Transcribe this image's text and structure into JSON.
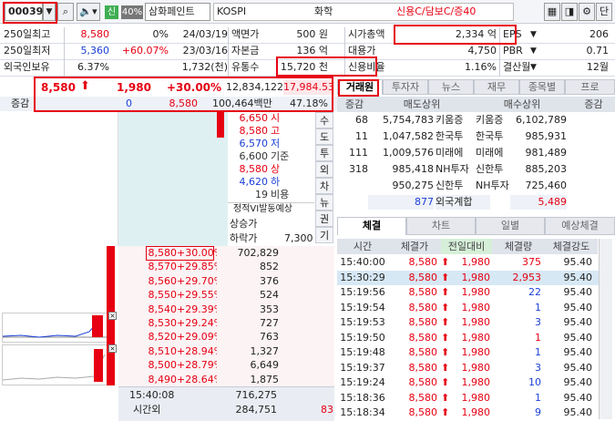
{
  "toolbar": {
    "code": "000390",
    "badge": "신",
    "pct": "40%",
    "name": "삼화페인트",
    "market": "KOSPI",
    "sector": "화학",
    "credit": "신용C/담보C/증40",
    "single_btn": "단"
  },
  "info": [
    [
      {
        "t": "250일최고"
      },
      {
        "t": "8,580",
        "c": "red"
      },
      {
        "t": "0%"
      },
      {
        "t": "24/03/19"
      },
      {
        "t": "액면가"
      },
      {
        "t": "500 원"
      },
      {
        "t": "시가총액"
      },
      {
        "t": "2,334 억"
      },
      {
        "t": "EPS"
      },
      {
        "t": "206"
      }
    ],
    [
      {
        "t": "250일최저"
      },
      {
        "t": "5,360",
        "c": "blue"
      },
      {
        "t": "+60.07%",
        "c": "red"
      },
      {
        "t": "23/03/16"
      },
      {
        "t": "자본금"
      },
      {
        "t": "136 억"
      },
      {
        "t": "대용가"
      },
      {
        "t": "4,750"
      },
      {
        "t": "PBR"
      },
      {
        "t": "0.71"
      }
    ],
    [
      {
        "t": "외국인보유"
      },
      {
        "t": "6.37%"
      },
      {
        "t": ""
      },
      {
        "t": "1,732(천)"
      },
      {
        "t": "유통수"
      },
      {
        "t": "15,720 천"
      },
      {
        "t": "신용비율"
      },
      {
        "t": "1.16%"
      },
      {
        "t": "결산월"
      },
      {
        "t": "12월"
      }
    ]
  ],
  "price": {
    "current": "8,580",
    "change": "1,980",
    "rate": "+30.00%",
    "volume": "12,834,122",
    "prev_vol": "17,984.53"
  },
  "summary": {
    "label": "증감",
    "left": "0",
    "price": "8,580",
    "amount": "100,464백만",
    "ratio": "47.18%"
  },
  "right_tabs": [
    "거래원",
    "투자자",
    "뉴스",
    "재무",
    "종목별",
    "프로"
  ],
  "broker": {
    "headers": [
      "증감",
      "매도상위",
      "매수상위",
      "증감"
    ],
    "rows": [
      [
        "68",
        "5,754,783",
        "키움증",
        "키움증",
        "6,102,789",
        ""
      ],
      [
        "11",
        "1,047,582",
        "한국투",
        "한국투",
        "985,931",
        ""
      ],
      [
        "111",
        "1,009,576",
        "미래에",
        "미래에",
        "981,489",
        ""
      ],
      [
        "318",
        "985,418",
        "NH투자",
        "신한투",
        "885,203",
        ""
      ],
      [
        "",
        "950,275",
        "신한투",
        "NH투자",
        "725,460",
        ""
      ]
    ],
    "foreign": [
      "877",
      "외국계합",
      "5,489"
    ]
  },
  "stats": [
    {
      "v": "6,650",
      "l": "시",
      "c": "red"
    },
    {
      "v": "8,580",
      "l": "고",
      "c": "red"
    },
    {
      "v": "6,570",
      "l": "저",
      "c": "blue"
    },
    {
      "v": "6,600",
      "l": "기준",
      "c": "dk"
    },
    {
      "v": "8,580",
      "l": "상",
      "c": "red"
    },
    {
      "v": "4,620",
      "l": "하",
      "c": "blue"
    },
    {
      "v": "19",
      "l": "비용",
      "c": "dk"
    }
  ],
  "side_menu": [
    "수",
    "도",
    "투",
    "외",
    "차",
    "뉴",
    "권",
    "기"
  ],
  "vi": {
    "title": "정적VI발동예상",
    "up_label": "상승가",
    "down_label": "하락가",
    "down_val": "7,300"
  },
  "book": [
    [
      "8,580",
      "+30.00%",
      "702,829"
    ],
    [
      "8,570",
      "+29.85%",
      "852"
    ],
    [
      "8,560",
      "+29.70%",
      "376"
    ],
    [
      "8,550",
      "+29.55%",
      "524"
    ],
    [
      "8,540",
      "+29.39%",
      "353"
    ],
    [
      "8,530",
      "+29.24%",
      "727"
    ],
    [
      "8,520",
      "+29.09%",
      "763"
    ],
    [
      "8,510",
      "+28.94%",
      "1,327"
    ],
    [
      "8,500",
      "+28.79%",
      "6,649"
    ],
    [
      "8,490",
      "+28.64%",
      "1,875"
    ]
  ],
  "book_footer": {
    "time": "15:40:08",
    "label": "시간외",
    "v1": "716,275",
    "v2": "284,751",
    "v3": "83"
  },
  "trade_tabs": [
    "체결",
    "차트",
    "일별",
    "예상체결"
  ],
  "trade_headers": [
    "시간",
    "체결가",
    "전일대비",
    "체결량",
    "체결강도"
  ],
  "trades": [
    [
      "15:40:00",
      "8,580",
      "1,980",
      "375",
      "95.40",
      "red"
    ],
    [
      "15:30:29",
      "8,580",
      "1,980",
      "2,953",
      "95.40",
      "red"
    ],
    [
      "15:19:56",
      "8,580",
      "1,980",
      "22",
      "95.40",
      "blue"
    ],
    [
      "15:19:54",
      "8,580",
      "1,980",
      "1",
      "95.40",
      "blue"
    ],
    [
      "15:19:53",
      "8,580",
      "1,980",
      "3",
      "95.40",
      "blue"
    ],
    [
      "15:19:50",
      "8,580",
      "1,980",
      "1",
      "95.40",
      "red"
    ],
    [
      "15:19:48",
      "8,580",
      "1,980",
      "1",
      "95.40",
      "blue"
    ],
    [
      "15:19:37",
      "8,580",
      "1,980",
      "3",
      "95.40",
      "blue"
    ],
    [
      "15:19:24",
      "8,580",
      "1,980",
      "10",
      "95.40",
      "blue"
    ],
    [
      "15:18:36",
      "8,580",
      "1,980",
      "1",
      "95.40",
      "blue"
    ],
    [
      "15:18:34",
      "8,580",
      "1,980",
      "9",
      "95.40",
      "blue"
    ]
  ]
}
